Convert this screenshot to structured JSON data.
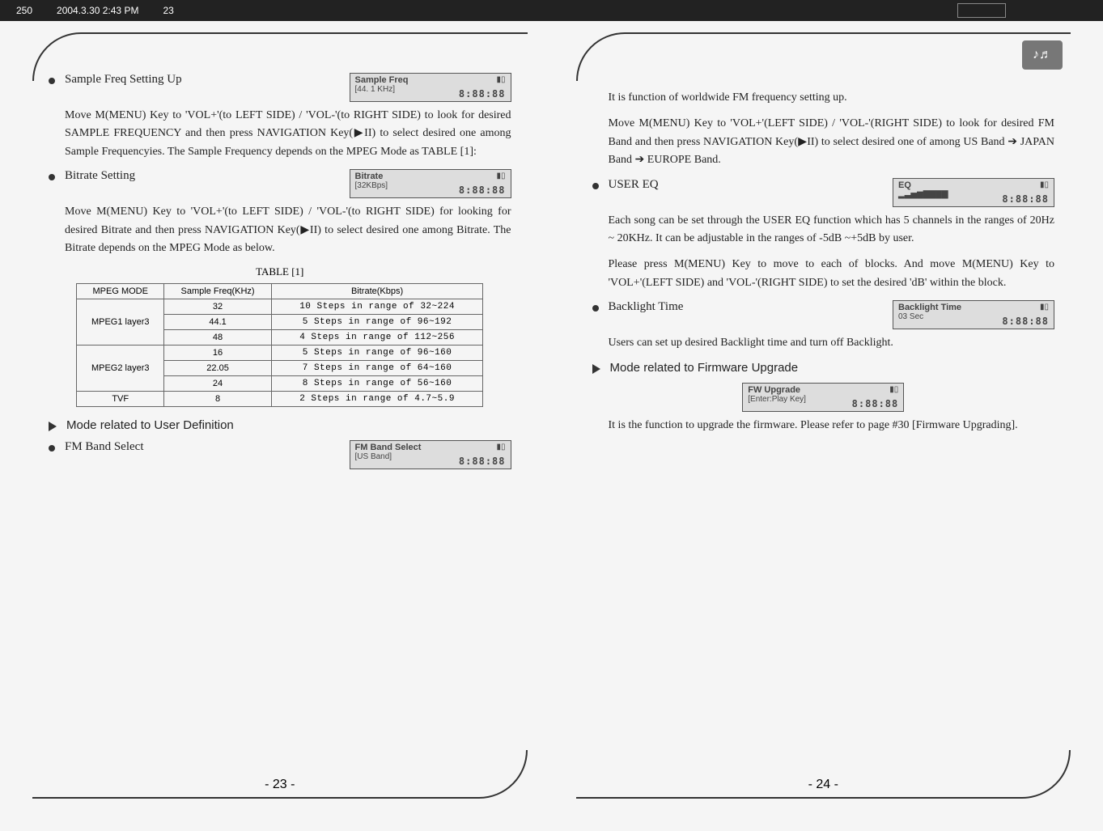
{
  "topbar": {
    "filename": "250",
    "timestamp": "2004.3.30 2:43 PM",
    "page_hint": "23"
  },
  "left": {
    "s1_label": "Sample Freq Setting Up",
    "s1_lcd_l1": "Sample Freq",
    "s1_lcd_l2": "[44. 1 KHz]",
    "s1_lcd_clock": "8:88:88",
    "s1_body": "Move M(MENU) Key to 'VOL+'(to LEFT SIDE) / 'VOL-'(to RIGHT SIDE) to look for desired  SAMPLE FREQUENCY and then press NAVIGATION Key(▶II) to select desired one among Sample Frequencyies. The Sample Frequency depends on the MPEG Mode as TABLE [1]:",
    "s2_label": "Bitrate Setting",
    "s2_lcd_l1": "Bitrate",
    "s2_lcd_l2": "[32KBps]",
    "s2_lcd_clock": "8:88:88",
    "s2_body": "Move M(MENU) Key to 'VOL+'(to LEFT SIDE) / 'VOL-'(to RIGHT SIDE) for looking for desired Bitrate and then press  NAVIGATION Key(▶II) to select desired one among Bitrate. The Bitrate depends on the MPEG Mode as below.",
    "table_title": "TABLE [1]",
    "table_headers": [
      "MPEG MODE",
      "Sample Freq(KHz)",
      "Bitrate(Kbps)"
    ],
    "table_rows": [
      {
        "mode": "MPEG1 layer3",
        "freq": "32",
        "rate": "10 Steps in range of 32~224"
      },
      {
        "mode": "",
        "freq": "44.1",
        "rate": "5 Steps in range of 96~192"
      },
      {
        "mode": "",
        "freq": "48",
        "rate": "4 Steps in range of 112~256"
      },
      {
        "mode": "MPEG2 layer3",
        "freq": "16",
        "rate": "5 Steps in range of 96~160"
      },
      {
        "mode": "",
        "freq": "22.05",
        "rate": "7 Steps in range of 64~160"
      },
      {
        "mode": "",
        "freq": "24",
        "rate": "8 Steps in range of 56~160"
      },
      {
        "mode": "TVF",
        "freq": "8",
        "rate": "2 Steps in range of 4.7~5.9"
      }
    ],
    "h1": "Mode related to User Definition",
    "s3_label": "FM Band Select",
    "s3_lcd_l1": "FM Band Select",
    "s3_lcd_l2": "[US Band]",
    "s3_lcd_clock": "8:88:88",
    "page_num": "-  23  -"
  },
  "right": {
    "intro1": "It is function of worldwide FM frequency setting up.",
    "intro2": "Move M(MENU) Key to 'VOL+'(LEFT SIDE) / 'VOL-'(RIGHT SIDE) to look for desired FM Band and then press  NAVIGATION Key(▶II) to select desired one of among US Band ➔ JAPAN Band ➔ EUROPE Band.",
    "s4_label": "USER EQ",
    "s4_lcd_l1": "EQ",
    "s4_lcd_l2": "▂▃▅▆▇▇▇▇",
    "s4_lcd_clock": "8:88:88",
    "s4_body1": "Each song can be set through the USER EQ function which has 5 channels in the ranges of 20Hz ~ 20KHz. It can be adjustable in the ranges of -5dB ~+5dB by user.",
    "s4_body2": "Please press M(MENU) Key to move to each of blocks. And move M(MENU) Key to 'VOL+'(LEFT SIDE) and 'VOL-'(RIGHT SIDE) to set the desired 'dB' within the block.",
    "s5_label": "Backlight Time",
    "s5_lcd_l1": "Backlight Time",
    "s5_lcd_l2": "03 Sec",
    "s5_lcd_clock": "8:88:88",
    "s5_body": "Users can set up desired Backlight time and turn off Backlight.",
    "h2": "Mode related to Firmware Upgrade",
    "s6_lcd_l1": "FW Upgrade",
    "s6_lcd_l2": "[Enter:Play Key]",
    "s6_lcd_clock": "8:88:88",
    "s6_body": "It is the function to upgrade the firmware. Please refer to page #30 [Firmware Upgrading].",
    "page_num": "-  24  -",
    "logo": "♪♬"
  }
}
